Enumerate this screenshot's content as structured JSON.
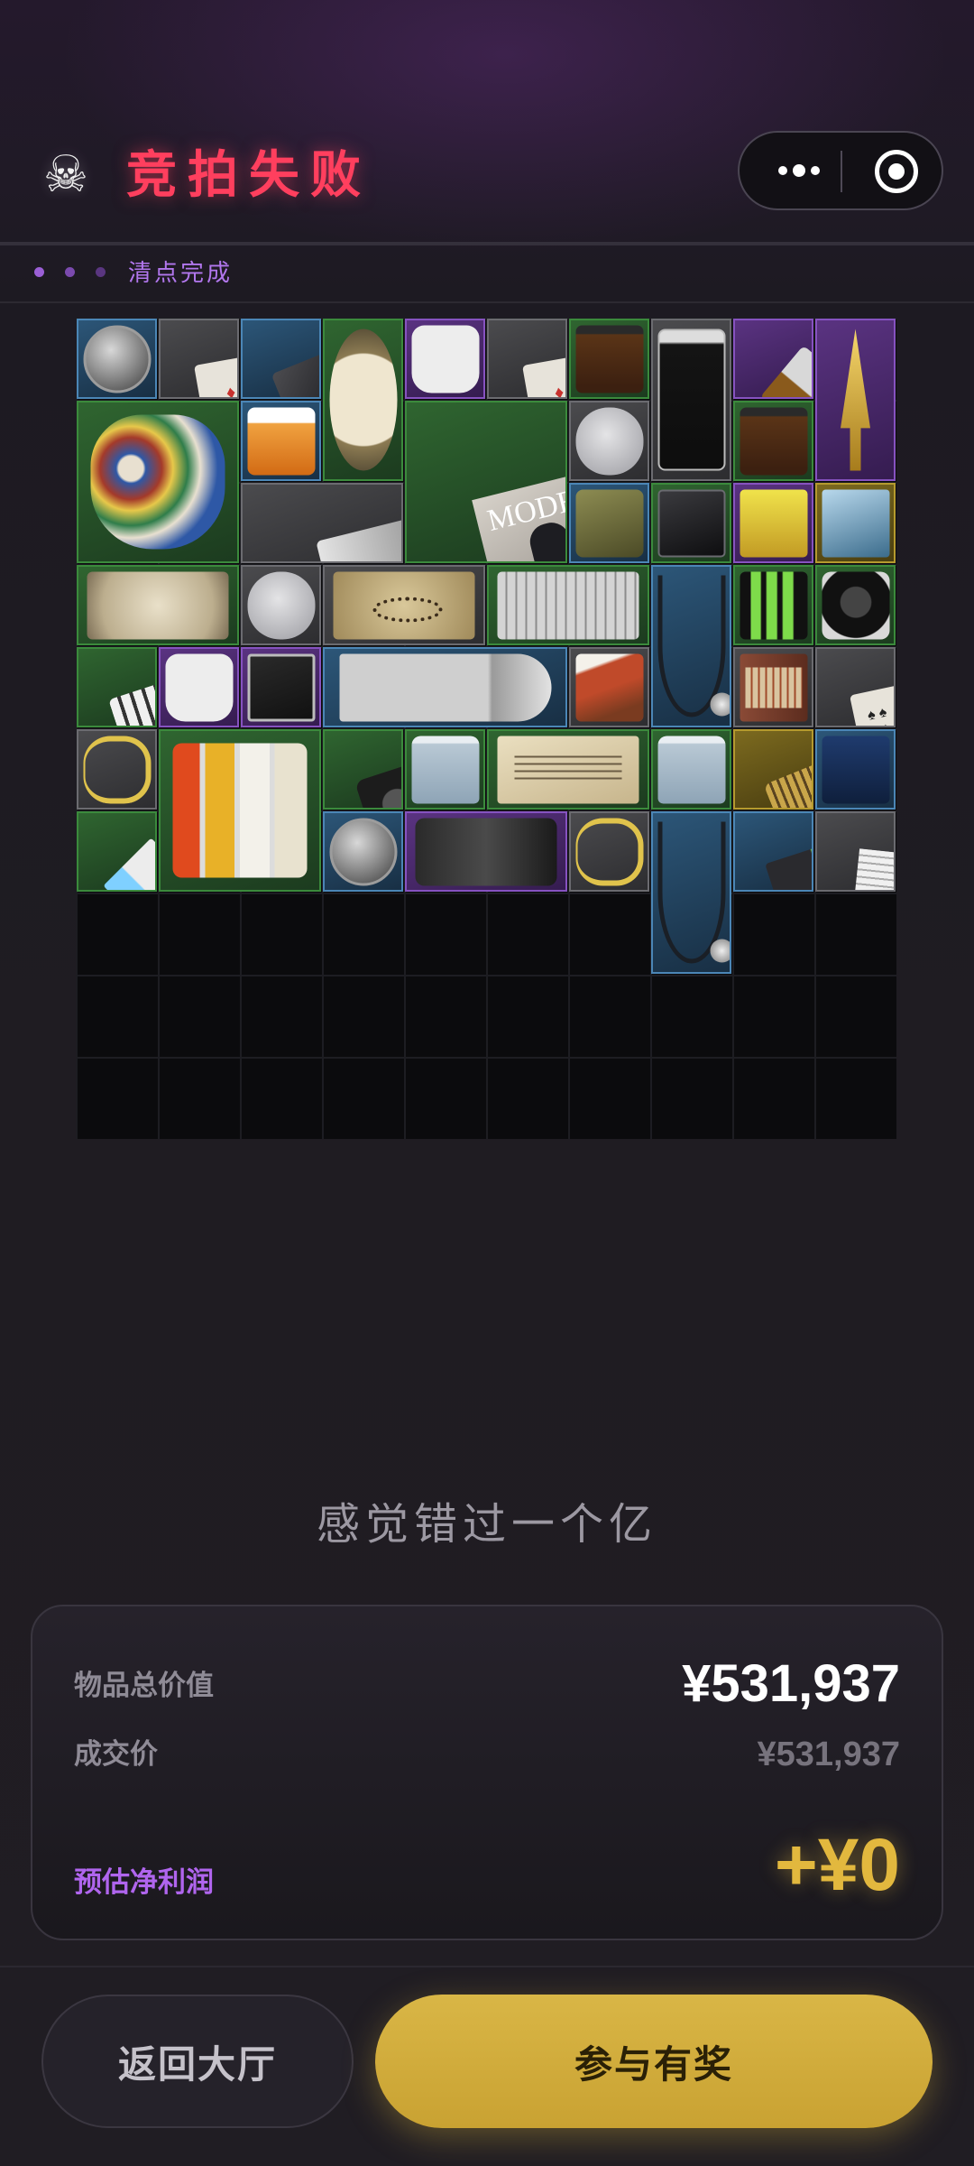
{
  "header": {
    "icon": "skull-icon",
    "title": "竞拍失败",
    "title_color": "#ff3f5e",
    "capsule": {
      "more_icon": "more-dots-icon",
      "close_icon": "target-close-icon"
    }
  },
  "status": {
    "text": "清点完成",
    "dots": 3,
    "accent": "#b277ee"
  },
  "inventory": {
    "columns": 10,
    "rows": 10,
    "filled_rows": 7,
    "items": [
      {
        "name": "coin",
        "rarity": "blue"
      },
      {
        "name": "playing-card",
        "rarity": "gray"
      },
      {
        "name": "phone",
        "rarity": "blue"
      },
      {
        "name": "pressure-gauge",
        "rarity": "green"
      },
      {
        "name": "body-armor-vest",
        "rarity": "purple"
      },
      {
        "name": "playing-card",
        "rarity": "gray"
      },
      {
        "name": "coffee-jar",
        "rarity": "green"
      },
      {
        "name": "sample-tube",
        "rarity": "gray"
      },
      {
        "name": "knife",
        "rarity": "purple"
      },
      {
        "name": "gold-trophy",
        "rarity": "purple"
      },
      {
        "name": "ceramic-pot",
        "rarity": "green"
      },
      {
        "name": "pill-bottle",
        "rarity": "blue"
      },
      {
        "name": "magazine",
        "rarity": "green"
      },
      {
        "name": "computer-mouse",
        "rarity": "gray"
      },
      {
        "name": "coffee-jar",
        "rarity": "green"
      },
      {
        "name": "utility-knife",
        "rarity": "gray"
      },
      {
        "name": "ration-tin",
        "rarity": "blue"
      },
      {
        "name": "hard-drive",
        "rarity": "green"
      },
      {
        "name": "energy-drink",
        "rarity": "purple"
      },
      {
        "name": "crystal-award",
        "rarity": "gold"
      },
      {
        "name": "old-map",
        "rarity": "green"
      },
      {
        "name": "computer-mouse",
        "rarity": "gray"
      },
      {
        "name": "treasure-map",
        "rarity": "gray"
      },
      {
        "name": "keyboard",
        "rarity": "green"
      },
      {
        "name": "stethoscope",
        "rarity": "blue"
      },
      {
        "name": "battery-pack",
        "rarity": "green"
      },
      {
        "name": "charging-dock",
        "rarity": "green"
      },
      {
        "name": "power-strip",
        "rarity": "green"
      },
      {
        "name": "body-armor-vest",
        "rarity": "purple"
      },
      {
        "name": "circuit-board",
        "rarity": "purple"
      },
      {
        "name": "machete",
        "rarity": "blue"
      },
      {
        "name": "ration-pack",
        "rarity": "gray"
      },
      {
        "name": "matches",
        "rarity": "gray"
      },
      {
        "name": "playing-card",
        "rarity": "gray"
      },
      {
        "name": "rope",
        "rarity": "gray"
      },
      {
        "name": "spice-rack",
        "rarity": "green"
      },
      {
        "name": "wireless-charger",
        "rarity": "green"
      },
      {
        "name": "water-bottle",
        "rarity": "green"
      },
      {
        "name": "document",
        "rarity": "green"
      },
      {
        "name": "water-bottle",
        "rarity": "green"
      },
      {
        "name": "cryptex",
        "rarity": "gold"
      },
      {
        "name": "coffee-bag",
        "rarity": "blue"
      },
      {
        "name": "syringe",
        "rarity": "green"
      },
      {
        "name": "coin",
        "rarity": "blue"
      },
      {
        "name": "flashlight",
        "rarity": "purple"
      },
      {
        "name": "rope",
        "rarity": "gray"
      },
      {
        "name": "stethoscope",
        "rarity": "blue"
      },
      {
        "name": "usb-drive",
        "rarity": "blue"
      },
      {
        "name": "paper-stack",
        "rarity": "gray"
      }
    ]
  },
  "tagline": "感觉错过一个亿",
  "summary": {
    "total_label": "物品总价值",
    "total_value": "¥531,937",
    "deal_label": "成交价",
    "deal_value": "¥531,937",
    "profit_label": "预估净利润",
    "profit_value": "+¥0",
    "profit_color": "#e2b83e"
  },
  "buttons": {
    "lobby": "返回大厅",
    "join": "参与有奖",
    "join_color": "#d9b646"
  }
}
